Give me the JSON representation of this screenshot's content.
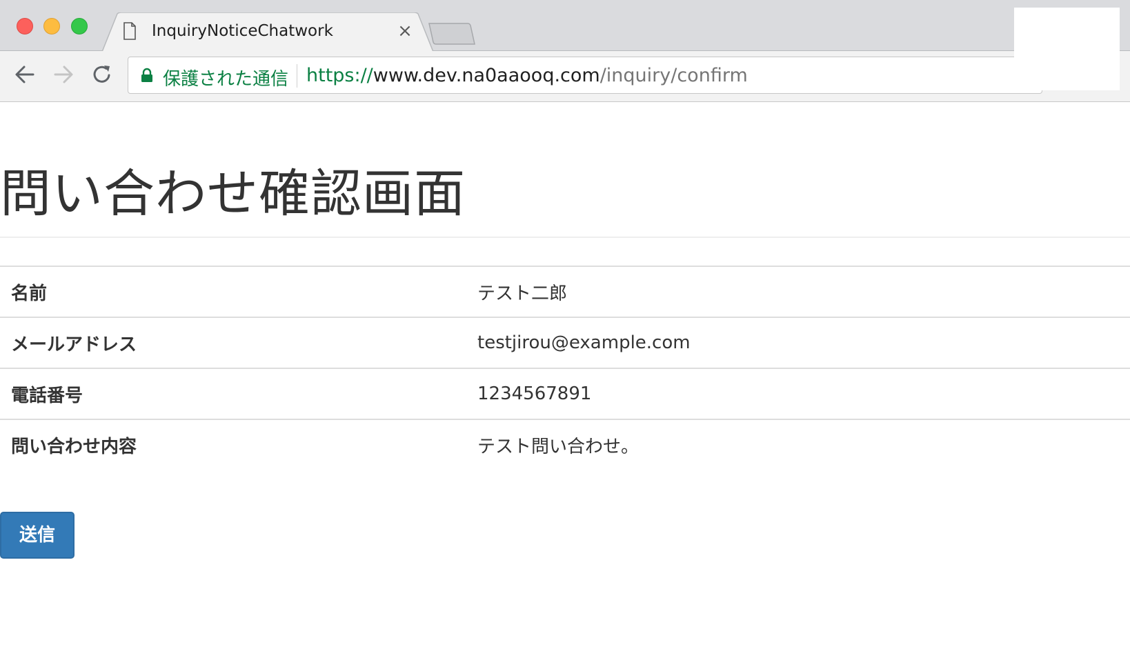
{
  "browser": {
    "tab": {
      "title": "InquiryNoticeChatwork",
      "close_glyph": "×",
      "icon": "file-icon"
    },
    "toolbar": {
      "back_icon": "arrow-left-icon",
      "forward_icon": "arrow-right-icon",
      "reload_icon": "reload-icon"
    },
    "omnibox": {
      "security_label": "保護された通信",
      "url_scheme": "https://",
      "url_host": "www.dev.na0aaooq.com",
      "url_path": "/inquiry/confirm",
      "security_color": "#0b8043"
    }
  },
  "page": {
    "title": "問い合わせ確認画面",
    "rows": [
      {
        "label": "名前",
        "value": "テスト二郎"
      },
      {
        "label": "メールアドレス",
        "value": "testjirou@example.com"
      },
      {
        "label": "電話番号",
        "value": "1234567891"
      },
      {
        "label": "問い合わせ内容",
        "value": "テスト問い合わせ。"
      }
    ],
    "submit_label": "送信",
    "accent_color": "#337ab7"
  }
}
